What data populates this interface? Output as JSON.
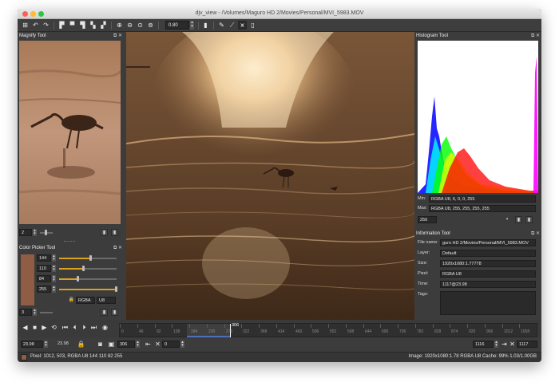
{
  "window": {
    "title": "djv_view - /Volumes/Maguro HD 2/Movies/Personal/MVI_5983.MOV"
  },
  "colors": {
    "close": "#fe5f57",
    "minimize": "#febc2e",
    "maximize": "#28c840",
    "accent": "#d9a21b",
    "picked_color": "#905c44"
  },
  "toolbar": {
    "icons": [
      "layout-icon",
      "rotate-left-icon",
      "rotate-right-icon",
      "align-top-left-icon",
      "align-top-icon",
      "align-top-right-icon",
      "fit-icon",
      "frame-icon",
      "zoom-in-icon",
      "zoom-out-icon",
      "zoom-reset-icon",
      "zoom-fit-icon",
      "fullscreen-icon",
      "color-picker-icon",
      "line-icon",
      "histogram-icon",
      "info-icon"
    ],
    "zoom_value": "0.80"
  },
  "magnify": {
    "title": "Magnify Tool",
    "zoom_value": "2"
  },
  "color_picker": {
    "title": "Color Picker Tool",
    "channels": [
      {
        "value": "144",
        "level": 0.56
      },
      {
        "value": "110",
        "level": 0.43
      },
      {
        "value": "84",
        "level": 0.33
      },
      {
        "value": "255",
        "level": 1.0
      }
    ],
    "format": "RGBA",
    "type": "U8",
    "size_value": "3"
  },
  "histogram": {
    "title": "Histogram Tool",
    "min_label": "Min:",
    "min_value": "RGBA U8, 6, 0, 0, 255",
    "max_label": "Max:",
    "max_value": "RGBA U8, 255, 255, 255, 255",
    "bins_value": "256"
  },
  "information": {
    "title": "Information Tool",
    "rows": [
      {
        "label": "File name:",
        "value": "guro HD 2/Movies/Personal/MVI_5983.MOV"
      },
      {
        "label": "Layer:",
        "value": "Default"
      },
      {
        "label": "Size:",
        "value": "1920x1080:1.77778"
      },
      {
        "label": "Pixel:",
        "value": "RGBA U8"
      },
      {
        "label": "Time:",
        "value": "1117@23.98"
      },
      {
        "label": "Tags:",
        "value": ""
      }
    ]
  },
  "timeline": {
    "current_frame": "306",
    "ticks": [
      "0",
      "46",
      "92",
      "138",
      "184",
      "230",
      "276",
      "322",
      "368",
      "414",
      "460",
      "506",
      "552",
      "598",
      "644",
      "690",
      "736",
      "782",
      "828",
      "874",
      "920",
      "966",
      "1012",
      "1058"
    ]
  },
  "playback": {
    "speed_value": "23.98",
    "speed_actual": "23.98",
    "frame_value": "306",
    "step_value": "0",
    "end_value": "1116",
    "duration_value": "1117"
  },
  "status": {
    "pixel_info": "Pixel: 1012, 503, RGBA U8 144 110 82 255",
    "image_info": "Image: 1920x1080:1.78 RGBA U8  Cache: 99% 1.03/1.00GB"
  }
}
